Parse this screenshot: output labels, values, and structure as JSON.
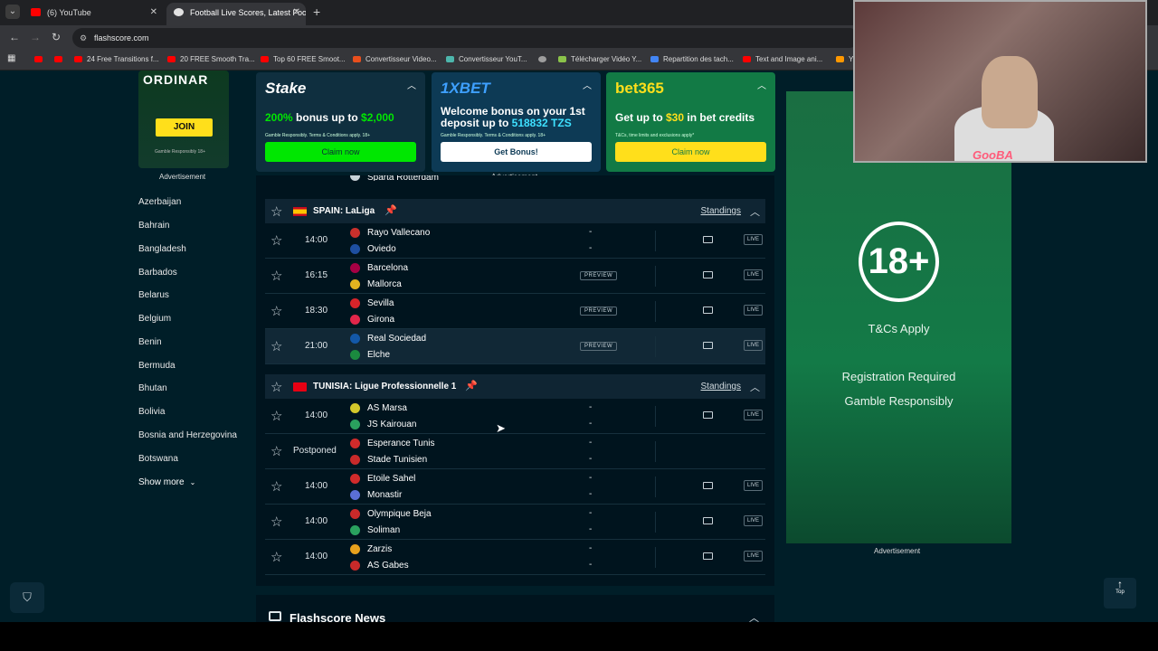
{
  "browser": {
    "tabs": [
      {
        "label": "(6) YouTube",
        "favicon_color": "#ff0000"
      },
      {
        "label": "Football Live Scores, Latest Foo",
        "favicon_color": "#e2e2e2"
      }
    ],
    "url": "flashscore.com",
    "bookmarks": [
      {
        "label": "",
        "color": "#ff0000"
      },
      {
        "label": "",
        "color": "#ff0000"
      },
      {
        "label": "24 Free Transitions f...",
        "color": "#ff0000"
      },
      {
        "label": "20 FREE Smooth Tra...",
        "color": "#ff0000"
      },
      {
        "label": "Top 60 FREE Smoot...",
        "color": "#ff0000"
      },
      {
        "label": "Convertisseur Video...",
        "color": "#e94f1d"
      },
      {
        "label": "Convertisseur YouT...",
        "color": "#4db6ac"
      },
      {
        "label": "",
        "color": "#9e9e9e"
      },
      {
        "label": "Télécharger Vidéo Y...",
        "color": "#8bc34a"
      },
      {
        "label": "Repartition des tach...",
        "color": "#4285f4"
      },
      {
        "label": "Text and Image ani...",
        "color": "#ff0000"
      },
      {
        "label": "Y",
        "color": "#ff9800"
      }
    ]
  },
  "left_ad": {
    "headline": "ORDINAR",
    "button": "JOIN",
    "small": "Gamble Responsibly 18+",
    "label": "Advertisement"
  },
  "countries": [
    "Azerbaijan",
    "Bahrain",
    "Bangladesh",
    "Barbados",
    "Belarus",
    "Belgium",
    "Benin",
    "Bermuda",
    "Bhutan",
    "Bolivia",
    "Bosnia and Herzegovina",
    "Botswana"
  ],
  "show_more": "Show more",
  "banners": [
    {
      "logo": "Stake",
      "text_pre": "200% ",
      "text_mid": "bonus up to ",
      "text_amount": "$2,000",
      "terms": "Gamble Responsibly. Terms & Conditions apply. 18+",
      "button": "Claim now",
      "bg": "#0f2f3f",
      "accent": "#00e701"
    },
    {
      "logo": "1XBET",
      "text_pre": "Welcome bonus on your 1st deposit up to ",
      "text_mid": "",
      "text_amount": "518832 TZS",
      "terms": "Gamble Responsibly. Terms & Conditions apply. 18+",
      "button": "Get Bonus!",
      "bg": "#0d3a55",
      "accent": "#3ee0ff"
    },
    {
      "logo": "bet365",
      "text_pre": "Get up to ",
      "text_mid": "",
      "text_amount": "$30",
      "text_post": " in bet credits",
      "terms": "T&Cs, time limits and exclusions apply*",
      "button": "Claim now",
      "bg": "#127a45",
      "accent": "#ffdf1b"
    }
  ],
  "banner_ad_label": "Advertisement",
  "prev_row_team": "Sparta Rotterdam",
  "leagues": [
    {
      "name": "SPAIN: LaLiga",
      "standings": "Standings",
      "matches": [
        {
          "time": "14:00",
          "home": "Rayo Vallecano",
          "away": "Oviedo",
          "home_score": "-",
          "away_score": "-",
          "preview": "",
          "live": "LIVE",
          "home_color": "#c9302c",
          "away_color": "#1e4fa0"
        },
        {
          "time": "16:15",
          "home": "Barcelona",
          "away": "Mallorca",
          "home_score": "",
          "away_score": "",
          "preview": "PREVIEW",
          "live": "LIVE",
          "home_color": "#a50044",
          "away_color": "#e2b320"
        },
        {
          "time": "18:30",
          "home": "Sevilla",
          "away": "Girona",
          "home_score": "",
          "away_score": "",
          "preview": "PREVIEW",
          "live": "LIVE",
          "home_color": "#d7242a",
          "away_color": "#e2264a"
        },
        {
          "time": "21:00",
          "home": "Real Sociedad",
          "away": "Elche",
          "home_score": "",
          "away_score": "",
          "preview": "PREVIEW",
          "live": "LIVE",
          "home_color": "#1358a8",
          "away_color": "#1b8a3f"
        }
      ]
    },
    {
      "name": "TUNISIA: Ligue Professionnelle 1",
      "standings": "Standings",
      "matches": [
        {
          "time": "14:00",
          "home": "AS Marsa",
          "away": "JS Kairouan",
          "home_score": "-",
          "away_score": "-",
          "preview": "",
          "live": "LIVE",
          "home_color": "#d4c82b",
          "away_color": "#2aa15e"
        },
        {
          "time": "Postponed",
          "home": "Esperance Tunis",
          "away": "Stade Tunisien",
          "home_score": "-",
          "away_score": "-",
          "preview": "",
          "live": "",
          "home_color": "#d12b2b",
          "away_color": "#c92a2a"
        },
        {
          "time": "14:00",
          "home": "Etoile Sahel",
          "away": "Monastir",
          "home_score": "-",
          "away_score": "-",
          "preview": "",
          "live": "LIVE",
          "home_color": "#d12b2b",
          "away_color": "#5a6fd6"
        },
        {
          "time": "14:00",
          "home": "Olympique Beja",
          "away": "Soliman",
          "home_score": "-",
          "away_score": "-",
          "preview": "",
          "live": "LIVE",
          "home_color": "#c92a2a",
          "away_color": "#2aa15e"
        },
        {
          "time": "14:00",
          "home": "Zarzis",
          "away": "AS Gabes",
          "home_score": "-",
          "away_score": "-",
          "preview": "",
          "live": "LIVE",
          "home_color": "#e8a21d",
          "away_color": "#c92a2a"
        }
      ]
    }
  ],
  "news_title": "Flashscore News",
  "right_ad": {
    "badge": "18+",
    "line1": "T&Cs Apply",
    "line2": "Registration Required",
    "line3": "Gamble Responsibly",
    "label": "Advertisement"
  },
  "top_button": "Top",
  "webcam_label": "GooBA"
}
